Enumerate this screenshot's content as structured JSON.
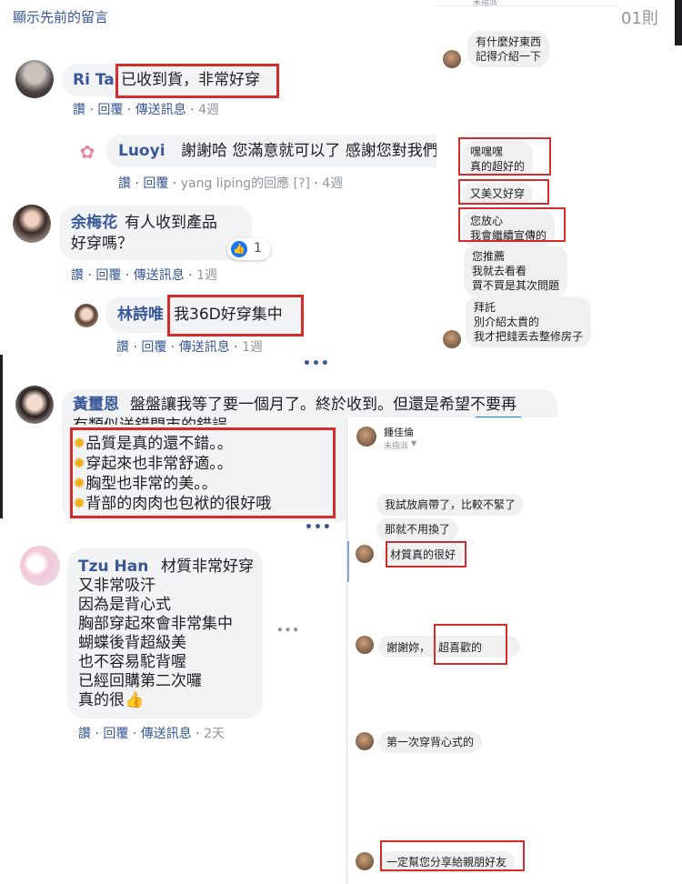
{
  "top": {
    "show_previous": "顯示先前的留言",
    "count_partial": "01則",
    "right_header_sub": "未指派"
  },
  "comments": {
    "rita": {
      "name": "Ri Ta",
      "text": "已收到貨，非常好穿",
      "like": "讚",
      "reply": "回覆",
      "message": "傳送訊息",
      "time": "4週"
    },
    "luoyi": {
      "name": "Luoyi",
      "text": "謝謝哈 您滿意就可以了 感謝您對我們",
      "like": "讚",
      "reply": "回覆",
      "replied_note": "yang liping的回應 [?]",
      "time": "4週"
    },
    "yu": {
      "name": "余梅花",
      "text1": "有人收到產品",
      "text2": "好穿嗎？",
      "reaction_count": "1",
      "like": "讚",
      "reply": "回覆",
      "message": "傳送訊息",
      "time": "1週"
    },
    "lin": {
      "name": "林詩唯",
      "text": "我36D好穿集中",
      "like": "讚",
      "reply": "回覆",
      "message": "傳送訊息",
      "time": "1週"
    },
    "more1": "•••",
    "huang": {
      "name": "黃璽恩",
      "text": "盤盤讓我等了要一個月了。終於收到。但還是希望不要再",
      "text2": "有類似送錯門市的錯誤。",
      "list": [
        "品質是真的還不錯。。",
        "穿起來也非常舒適。。",
        "胸型也非常的美。。",
        "背部的肉肉也包袱的很好哦"
      ]
    },
    "more2": "•••",
    "tzu": {
      "name": "Tzu Han",
      "lines": [
        "材質非常好穿",
        "又非常吸汗",
        "因為是背心式",
        "胸部穿起來會非常集中",
        "蝴蝶後背超級美",
        "也不容易駝背喔",
        "已經回購第二次囉",
        "真的很"
      ],
      "like": "讚",
      "reply": "回覆",
      "message": "傳送訊息",
      "time": "2天"
    }
  },
  "chat1": {
    "messages": [
      "有什麼好東西\n記得介紹一下",
      "嘿嘿嘿\n真的超好的",
      "又美又好穿",
      "您放心\n我會繼續宣傳的",
      "您推薦\n我就去看看\n買不買是其次問題",
      "拜託\n別介紹太貴的\n我才把錢丟去整修房子"
    ]
  },
  "chat2": {
    "header_name": "鍾佳倫",
    "header_sub": "未指派",
    "messages": [
      "我試放肩帶了，比較不緊了",
      "那就不用換了",
      "材質真的很好",
      "謝謝妳，",
      "超喜歡的",
      "第一次穿背心式的",
      "一定幫您分享給親朋好友"
    ]
  },
  "colors": {
    "link": "#385898",
    "meta": "#90949c",
    "bubble": "#f2f3f5",
    "highlight": "#d62b2b"
  }
}
